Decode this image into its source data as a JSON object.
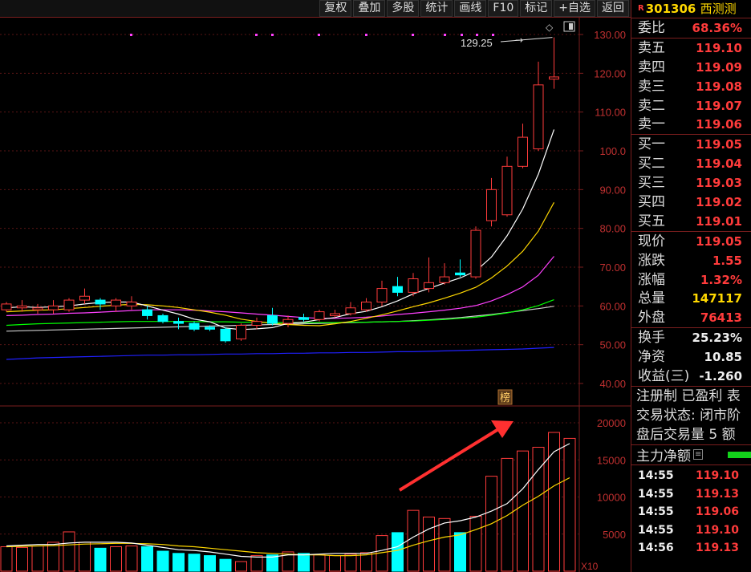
{
  "toolbar": {
    "items": [
      "复权",
      "叠加",
      "多股",
      "统计",
      "画线",
      "F10",
      "标记",
      "+自选",
      "返回"
    ]
  },
  "stock": {
    "r_mark": "R",
    "code": "301306",
    "name": "西测测"
  },
  "weibi": {
    "label": "委比",
    "value": "68.36%"
  },
  "sells": [
    {
      "label": "卖五",
      "price": "119.10"
    },
    {
      "label": "卖四",
      "price": "119.09"
    },
    {
      "label": "卖三",
      "price": "119.08"
    },
    {
      "label": "卖二",
      "price": "119.07"
    },
    {
      "label": "卖一",
      "price": "119.06"
    }
  ],
  "buys": [
    {
      "label": "买一",
      "price": "119.05"
    },
    {
      "label": "买二",
      "price": "119.04"
    },
    {
      "label": "买三",
      "price": "119.03"
    },
    {
      "label": "买四",
      "price": "119.02"
    },
    {
      "label": "买五",
      "price": "119.01"
    }
  ],
  "quote": [
    {
      "label": "现价",
      "value": "119.05",
      "color": "#ff3b3b"
    },
    {
      "label": "涨跌",
      "value": "1.55",
      "color": "#ff3b3b"
    },
    {
      "label": "涨幅",
      "value": "1.32%",
      "color": "#ff3b3b"
    },
    {
      "label": "总量",
      "value": "147117",
      "color": "#ffd800"
    },
    {
      "label": "外盘",
      "value": "76413",
      "color": "#ff3b3b"
    }
  ],
  "stats": [
    {
      "label": "换手",
      "value": "25.23%"
    },
    {
      "label": "净资",
      "value": "10.85"
    },
    {
      "label": "收益(三)",
      "value": "-1.260"
    }
  ],
  "info_lines": [
    "注册制 已盈利 表",
    "交易状态: 闭市阶",
    "盘后交易量 5 额"
  ],
  "main_flow": {
    "label": "主力净额"
  },
  "ticks": [
    {
      "time": "14:55",
      "price": "119.10"
    },
    {
      "time": "14:55",
      "price": "119.13"
    },
    {
      "time": "14:55",
      "price": "119.06"
    },
    {
      "time": "14:55",
      "price": "119.10"
    },
    {
      "time": "14:56",
      "price": "119.13"
    }
  ],
  "chart_data": {
    "type": "candlestick",
    "price_axis": {
      "ticks": [
        "130.00",
        "120.00",
        "110.00",
        "100.0",
        "90.00",
        "80.00",
        "70.00",
        "60.00",
        "50.00",
        "40.00"
      ],
      "min": 40,
      "max": 130
    },
    "volume_axis": {
      "ticks": [
        "20000",
        "15000",
        "10000",
        "5000"
      ],
      "unit": "X10",
      "max": 20000
    },
    "high_annotation": "129.25",
    "marker_label": "榜",
    "colors": {
      "up": "#ff3b3b",
      "down": "#00ffff",
      "ma5": "#ffffff",
      "ma10": "#ffd800",
      "ma20": "#ff40ff",
      "ma60": "#00ff00",
      "ma120": "#cccccc",
      "ma250": "#2020ff"
    },
    "candles": [
      {
        "o": 59.0,
        "c": 60.5,
        "h": 61.0,
        "l": 58.5
      },
      {
        "o": 59.5,
        "c": 60.0,
        "h": 61.5,
        "l": 58.5
      },
      {
        "o": 59.0,
        "c": 59.5,
        "h": 60.5,
        "l": 58.0
      },
      {
        "o": 59.0,
        "c": 60.0,
        "h": 61.5,
        "l": 58.0
      },
      {
        "o": 59.0,
        "c": 61.5,
        "h": 62.0,
        "l": 58.5
      },
      {
        "o": 61.5,
        "c": 62.5,
        "h": 64.5,
        "l": 60.5
      },
      {
        "o": 61.5,
        "c": 60.5,
        "h": 62.0,
        "l": 59.0
      },
      {
        "o": 60.0,
        "c": 61.5,
        "h": 62.0,
        "l": 58.5
      },
      {
        "o": 60.0,
        "c": 61.0,
        "h": 62.5,
        "l": 59.0
      },
      {
        "o": 59.0,
        "c": 57.5,
        "h": 60.0,
        "l": 56.5
      },
      {
        "o": 57.5,
        "c": 56.0,
        "h": 58.0,
        "l": 55.5
      },
      {
        "o": 56.0,
        "c": 55.5,
        "h": 57.0,
        "l": 54.0
      },
      {
        "o": 55.5,
        "c": 54.0,
        "h": 56.0,
        "l": 53.5
      },
      {
        "o": 54.5,
        "c": 54.0,
        "h": 55.0,
        "l": 53.5
      },
      {
        "o": 54.0,
        "c": 51.0,
        "h": 54.5,
        "l": 50.5
      },
      {
        "o": 51.5,
        "c": 55.0,
        "h": 55.5,
        "l": 51.0
      },
      {
        "o": 55.0,
        "c": 56.0,
        "h": 57.0,
        "l": 54.0
      },
      {
        "o": 57.5,
        "c": 55.5,
        "h": 59.5,
        "l": 55.0
      },
      {
        "o": 55.5,
        "c": 56.5,
        "h": 57.5,
        "l": 54.5
      },
      {
        "o": 57.0,
        "c": 56.5,
        "h": 58.0,
        "l": 56.0
      },
      {
        "o": 56.5,
        "c": 58.5,
        "h": 59.0,
        "l": 56.0
      },
      {
        "o": 57.5,
        "c": 58.0,
        "h": 59.0,
        "l": 57.0
      },
      {
        "o": 58.0,
        "c": 59.5,
        "h": 61.0,
        "l": 57.5
      },
      {
        "o": 59.0,
        "c": 61.0,
        "h": 62.0,
        "l": 58.5
      },
      {
        "o": 61.0,
        "c": 64.5,
        "h": 66.5,
        "l": 60.0
      },
      {
        "o": 65.0,
        "c": 63.5,
        "h": 67.5,
        "l": 62.5
      },
      {
        "o": 63.5,
        "c": 67.0,
        "h": 68.5,
        "l": 62.5
      },
      {
        "o": 64.5,
        "c": 66.0,
        "h": 72.5,
        "l": 63.5
      },
      {
        "o": 66.0,
        "c": 67.5,
        "h": 71.0,
        "l": 65.5
      },
      {
        "o": 68.5,
        "c": 68.0,
        "h": 72.0,
        "l": 67.5
      },
      {
        "o": 67.5,
        "c": 79.5,
        "h": 80.5,
        "l": 67.0
      },
      {
        "o": 82.0,
        "c": 90.0,
        "h": 93.0,
        "l": 80.5
      },
      {
        "o": 83.5,
        "c": 96.0,
        "h": 98.5,
        "l": 83.0
      },
      {
        "o": 96.0,
        "c": 103.5,
        "h": 107.0,
        "l": 95.5
      },
      {
        "o": 100.5,
        "c": 117.0,
        "h": 123.0,
        "l": 100.0
      },
      {
        "o": 118.5,
        "c": 119.05,
        "h": 129.25,
        "l": 116.0
      }
    ],
    "ma5": [
      59.5,
      59.8,
      59.6,
      59.8,
      60.0,
      60.5,
      60.9,
      61.0,
      61.0,
      60.0,
      58.9,
      57.9,
      56.6,
      55.9,
      54.3,
      53.9,
      54.1,
      54.4,
      55.5,
      55.8,
      56.5,
      57.0,
      58.0,
      58.6,
      59.8,
      61.3,
      63.1,
      64.5,
      65.9,
      67.2,
      69.0,
      72.6,
      78.1,
      85.0,
      94.0,
      105.5
    ],
    "ma10": [
      58.5,
      58.7,
      58.9,
      59.0,
      59.3,
      59.6,
      59.9,
      60.2,
      60.4,
      60.3,
      60.0,
      59.6,
      59.0,
      58.4,
      57.6,
      56.6,
      56.0,
      55.5,
      55.2,
      55.0,
      54.9,
      55.4,
      56.0,
      56.8,
      57.7,
      58.7,
      59.8,
      60.8,
      62.0,
      63.3,
      64.8,
      67.2,
      70.3,
      74.1,
      79.3,
      86.7
    ],
    "ma20": [
      57.5,
      57.6,
      57.8,
      57.9,
      58.1,
      58.2,
      58.4,
      58.6,
      58.8,
      59.0,
      59.0,
      59.0,
      58.9,
      58.7,
      58.5,
      58.2,
      57.9,
      57.6,
      57.3,
      57.0,
      56.8,
      56.8,
      56.9,
      57.1,
      57.4,
      57.8,
      58.1,
      58.5,
      58.9,
      59.4,
      60.1,
      61.3,
      62.9,
      64.9,
      67.9,
      72.8
    ],
    "ma60": [
      55.0,
      55.2,
      55.4,
      55.5,
      55.6,
      55.7,
      55.8,
      55.9,
      56.0,
      56.0,
      56.0,
      56.0,
      56.0,
      55.9,
      55.9,
      55.8,
      55.8,
      55.7,
      55.7,
      55.7,
      55.7,
      55.7,
      55.8,
      55.8,
      55.9,
      56.0,
      56.1,
      56.3,
      56.5,
      56.8,
      57.1,
      57.6,
      58.2,
      59.0,
      60.1,
      61.6
    ],
    "ma120": [
      53.5,
      53.6,
      53.7,
      53.8,
      53.9,
      54.0,
      54.1,
      54.2,
      54.3,
      54.4,
      54.5,
      54.6,
      54.7,
      54.8,
      54.9,
      55.0,
      55.1,
      55.2,
      55.3,
      55.4,
      55.5,
      55.6,
      55.7,
      55.8,
      55.9,
      56.0,
      56.2,
      56.4,
      56.7,
      57.0,
      57.4,
      57.8,
      58.3,
      58.8,
      59.3,
      59.9
    ],
    "ma250": [
      46.2,
      46.4,
      46.6,
      46.7,
      46.8,
      46.9,
      47.0,
      47.1,
      47.2,
      47.3,
      47.3,
      47.4,
      47.4,
      47.5,
      47.6,
      47.6,
      47.7,
      47.7,
      47.8,
      47.8,
      47.9,
      47.9,
      48.0,
      48.0,
      48.1,
      48.2,
      48.2,
      48.3,
      48.4,
      48.5,
      48.6,
      48.7,
      48.8,
      48.9,
      49.1,
      49.3
    ],
    "volumes": [
      3300,
      3200,
      3400,
      3900,
      5300,
      3900,
      3100,
      3300,
      3400,
      3300,
      2700,
      2400,
      2300,
      2100,
      1600,
      1300,
      2100,
      2200,
      2600,
      2400,
      2200,
      2100,
      2300,
      2500,
      4800,
      5200,
      8200,
      7300,
      7100,
      5200,
      7400,
      12800,
      15200,
      16200,
      16700,
      18700,
      17900
    ],
    "vol_ma5": [
      3400,
      3500,
      3600,
      3600,
      3800,
      3900,
      3900,
      3900,
      3800,
      3500,
      3200,
      2900,
      2800,
      2600,
      2300,
      2000,
      1900,
      1900,
      2200,
      2200,
      2300,
      2400,
      2400,
      2400,
      2800,
      3300,
      4600,
      5700,
      6500,
      6800,
      7300,
      8100,
      9100,
      11100,
      13700,
      16100,
      17200
    ],
    "vol_ma10": [
      3300,
      3350,
      3400,
      3450,
      3550,
      3650,
      3700,
      3750,
      3750,
      3700,
      3600,
      3400,
      3300,
      3100,
      2900,
      2700,
      2500,
      2400,
      2300,
      2200,
      2200,
      2100,
      2100,
      2200,
      2500,
      2800,
      3500,
      4100,
      4600,
      4900,
      5600,
      6400,
      7500,
      8900,
      10100,
      11500,
      12600
    ]
  }
}
